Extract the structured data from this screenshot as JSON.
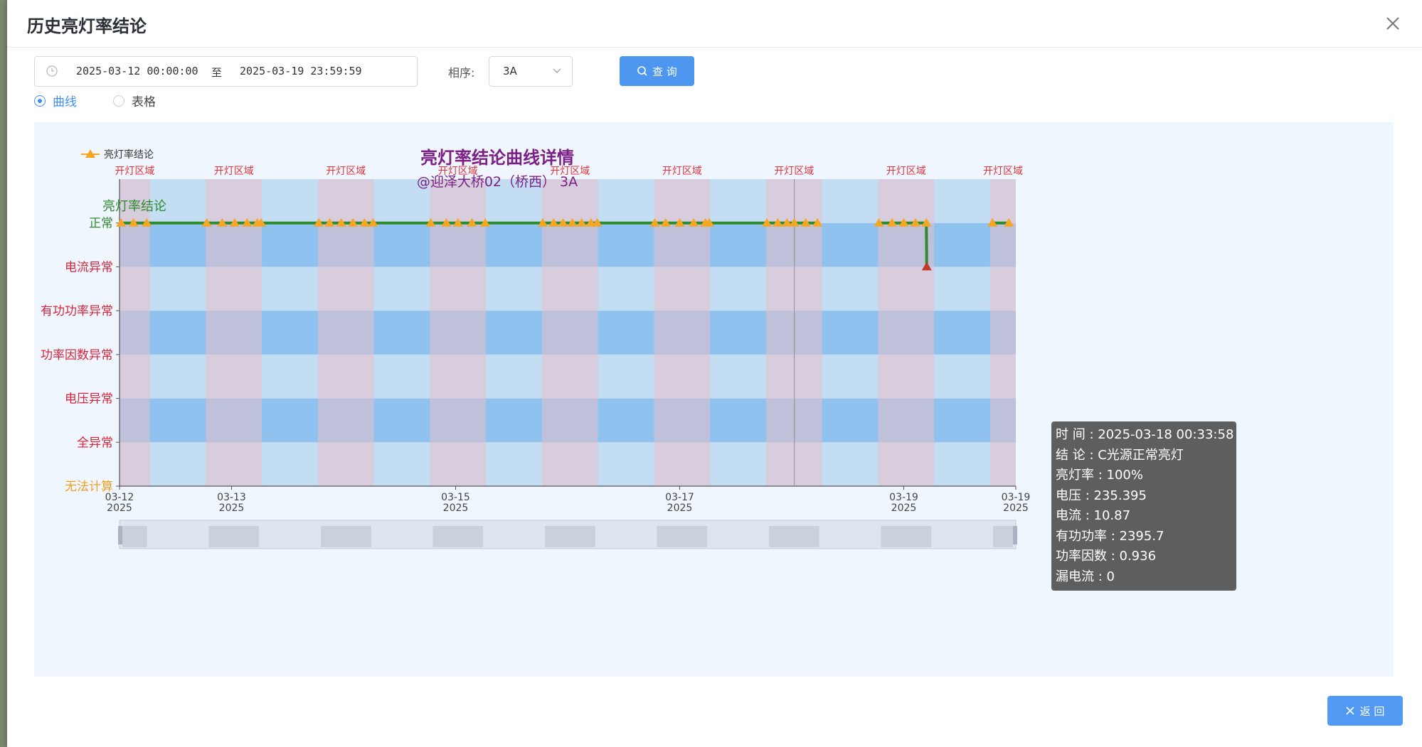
{
  "dialog": {
    "title": "历史亮灯率结论"
  },
  "filters": {
    "start": "2025-03-12 00:00:00",
    "separator": "至",
    "end": "2025-03-19 23:59:59",
    "phase_label": "相序:",
    "phase_value": "3A",
    "query_label": "查 询"
  },
  "view_toggle": {
    "curve_label": "曲线",
    "table_label": "表格",
    "selected": "curve"
  },
  "chart_data": {
    "type": "line",
    "title": "亮灯率结论曲线详情",
    "subtitle": "@迎泽大桥02（桥西） 3A",
    "ylabel": "亮灯率结论",
    "legend": {
      "label": "亮灯率结论",
      "placement": "top-left"
    },
    "y_categories": [
      "无法计算",
      "全异常",
      "电压异常",
      "功率因数异常",
      "有功功率异常",
      "电流异常",
      "正常"
    ],
    "y_category_colors": [
      "#f0a020",
      "#d6243b",
      "#d6243b",
      "#d6243b",
      "#d6243b",
      "#d6243b",
      "#2e8b2e"
    ],
    "x_range": [
      "2025-03-12 00:00",
      "2025-03-19 24:00"
    ],
    "x_ticks": [
      {
        "day": "03-12",
        "year": "2025",
        "date": "2025-03-12 00:00"
      },
      {
        "day": "03-13",
        "year": "2025",
        "date": "2025-03-13 00:00"
      },
      {
        "day": "03-15",
        "year": "2025",
        "date": "2025-03-15 00:00"
      },
      {
        "day": "03-17",
        "year": "2025",
        "date": "2025-03-17 00:00"
      },
      {
        "day": "03-19",
        "year": "2025",
        "date": "2025-03-19 00:00"
      },
      {
        "day": "03-19",
        "year": "2025",
        "date": "2025-03-20 00:00"
      }
    ],
    "lights_on_label": "开灯区域",
    "lights_on_regions": [
      {
        "from": "2025-03-12 00:00",
        "to": "2025-03-12 06:30"
      },
      {
        "from": "2025-03-12 18:30",
        "to": "2025-03-13 06:30"
      },
      {
        "from": "2025-03-13 18:30",
        "to": "2025-03-14 06:30"
      },
      {
        "from": "2025-03-14 18:30",
        "to": "2025-03-15 06:30"
      },
      {
        "from": "2025-03-15 18:30",
        "to": "2025-03-16 06:30"
      },
      {
        "from": "2025-03-16 18:30",
        "to": "2025-03-17 06:30"
      },
      {
        "from": "2025-03-17 18:30",
        "to": "2025-03-18 06:30"
      },
      {
        "from": "2025-03-18 18:30",
        "to": "2025-03-19 06:30"
      },
      {
        "from": "2025-03-19 18:30",
        "to": "2025-03-20 00:00"
      }
    ],
    "series": [
      {
        "name": "亮灯率结论",
        "color": "#2e8b2e",
        "marker_color": "#f5a623",
        "points": [
          {
            "x": "2025-03-12 00:20",
            "y": "正常"
          },
          {
            "x": "2025-03-12 03:00",
            "y": "正常"
          },
          {
            "x": "2025-03-12 05:50",
            "y": "正常"
          },
          {
            "x": "2025-03-12 18:40",
            "y": "正常"
          },
          {
            "x": "2025-03-12 22:00",
            "y": "正常"
          },
          {
            "x": "2025-03-13 00:40",
            "y": "正常"
          },
          {
            "x": "2025-03-13 03:20",
            "y": "正常"
          },
          {
            "x": "2025-03-13 05:30",
            "y": "正常"
          },
          {
            "x": "2025-03-13 06:20",
            "y": "正常"
          },
          {
            "x": "2025-03-13 18:40",
            "y": "正常"
          },
          {
            "x": "2025-03-13 21:00",
            "y": "正常"
          },
          {
            "x": "2025-03-13 23:30",
            "y": "正常"
          },
          {
            "x": "2025-03-14 02:00",
            "y": "正常"
          },
          {
            "x": "2025-03-14 04:30",
            "y": "正常"
          },
          {
            "x": "2025-03-14 06:20",
            "y": "正常"
          },
          {
            "x": "2025-03-14 18:40",
            "y": "正常"
          },
          {
            "x": "2025-03-14 22:00",
            "y": "正常"
          },
          {
            "x": "2025-03-15 00:30",
            "y": "正常"
          },
          {
            "x": "2025-03-15 03:30",
            "y": "正常"
          },
          {
            "x": "2025-03-15 06:20",
            "y": "正常"
          },
          {
            "x": "2025-03-15 18:40",
            "y": "正常"
          },
          {
            "x": "2025-03-15 21:00",
            "y": "正常"
          },
          {
            "x": "2025-03-15 23:00",
            "y": "正常"
          },
          {
            "x": "2025-03-16 01:00",
            "y": "正常"
          },
          {
            "x": "2025-03-16 03:00",
            "y": "正常"
          },
          {
            "x": "2025-03-16 05:00",
            "y": "正常"
          },
          {
            "x": "2025-03-16 06:20",
            "y": "正常"
          },
          {
            "x": "2025-03-16 18:40",
            "y": "正常"
          },
          {
            "x": "2025-03-16 21:00",
            "y": "正常"
          },
          {
            "x": "2025-03-17 00:00",
            "y": "正常"
          },
          {
            "x": "2025-03-17 03:00",
            "y": "正常"
          },
          {
            "x": "2025-03-17 05:30",
            "y": "正常"
          },
          {
            "x": "2025-03-17 06:20",
            "y": "正常"
          },
          {
            "x": "2025-03-17 18:40",
            "y": "正常"
          },
          {
            "x": "2025-03-17 21:00",
            "y": "正常"
          },
          {
            "x": "2025-03-17 23:00",
            "y": "正常"
          },
          {
            "x": "2025-03-18 00:33",
            "y": "正常"
          },
          {
            "x": "2025-03-18 03:00",
            "y": "正常"
          },
          {
            "x": "2025-03-18 05:30",
            "y": "正常"
          },
          {
            "x": "2025-03-18 18:40",
            "y": "正常"
          },
          {
            "x": "2025-03-18 21:30",
            "y": "正常"
          },
          {
            "x": "2025-03-19 00:00",
            "y": "正常"
          },
          {
            "x": "2025-03-19 02:30",
            "y": "正常"
          },
          {
            "x": "2025-03-19 04:50",
            "y": "正常"
          },
          {
            "x": "2025-03-19 04:55",
            "y": "电流异常"
          },
          {
            "x": "2025-03-19 19:00",
            "y": "正常"
          },
          {
            "x": "2025-03-19 22:30",
            "y": "正常"
          }
        ]
      }
    ],
    "hover_x": "2025-03-18 00:33"
  },
  "tooltip": {
    "lines": [
      "时 间 : 2025-03-18 00:33:58",
      "结 论 : C光源正常亮灯",
      "亮灯率 : 100%",
      "电压 : 235.395",
      "电流 : 10.87",
      "有功功率 : 2395.7",
      "功率因数 : 0.936",
      "漏电流 : 0"
    ]
  },
  "footer": {
    "return_label": "返 回"
  }
}
